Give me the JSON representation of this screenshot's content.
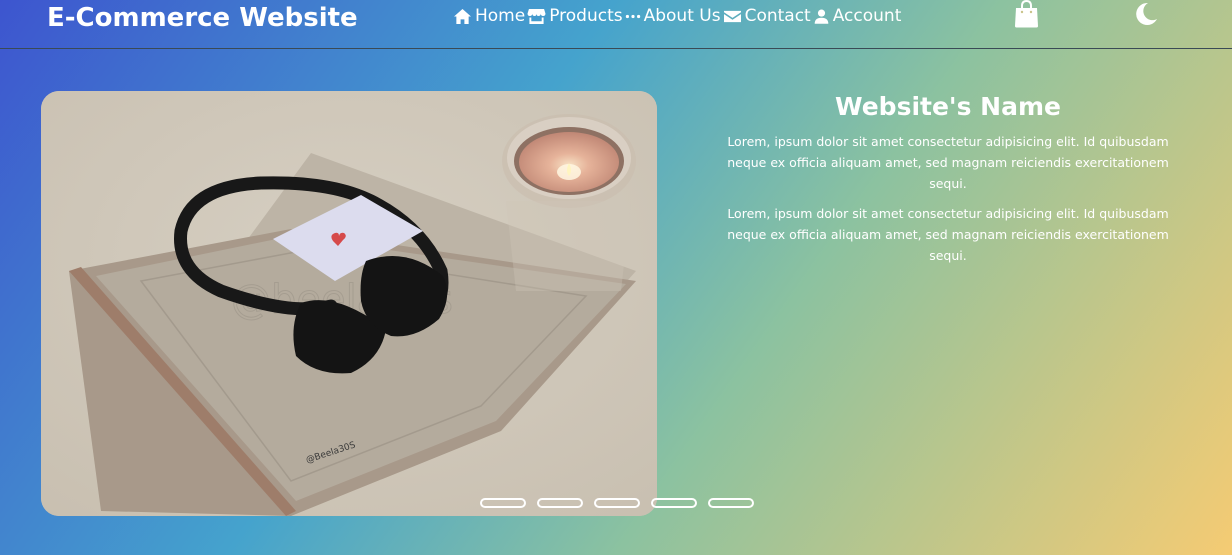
{
  "brand": "E-Commerce Website",
  "nav": {
    "home": "Home",
    "products": "Products",
    "about": "About Us",
    "contact": "Contact",
    "account": "Account"
  },
  "icons": {
    "home": "home-icon",
    "products": "store-icon",
    "about": "ellipsis-icon",
    "contact": "envelope-icon",
    "account": "user-icon",
    "cart": "shopping-bag-icon",
    "theme": "moon-icon"
  },
  "hero": {
    "image_watermark": "@beela30s",
    "image_signature": "@Beela30S"
  },
  "info": {
    "title": "Website's Name",
    "paragraph1": "Lorem, ipsum dolor sit amet consectetur adipisicing elit. Id quibusdam neque ex officia aliquam amet, sed magnam reiciendis exercitationem sequi.",
    "paragraph2": "Lorem, ipsum dolor sit amet consectetur adipisicing elit. Id quibusdam neque ex officia aliquam amet, sed magnam reiciendis exercitationem sequi."
  },
  "slider": {
    "slide_count": 5
  },
  "colors": {
    "gradient_start": "#3d55cf",
    "gradient_mid": "#45a3cd",
    "gradient_end": "#f5cb73"
  }
}
